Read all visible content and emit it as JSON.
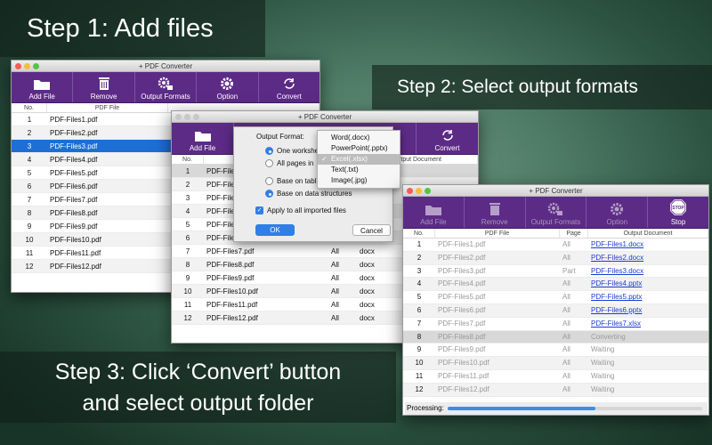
{
  "steps": {
    "step1": "Step 1: Add files",
    "step2": "Step 2: Select output formats",
    "step3_line1": "Step 3: Click ‘Convert’ button",
    "step3_line2": "and select output folder"
  },
  "app_title": "+ PDF Converter",
  "toolbar": {
    "add_file": "Add File",
    "remove": "Remove",
    "output_formats": "Output Formats",
    "option": "Option",
    "convert": "Convert",
    "stop": "Stop",
    "stop_sign": "STOP"
  },
  "columns": {
    "no": "No.",
    "pdf_file": "PDF File",
    "page": "Page",
    "output_document": "Output Document"
  },
  "window1": {
    "rows": [
      {
        "no": "1",
        "file": "PDF-Files1.pdf"
      },
      {
        "no": "2",
        "file": "PDF-Files2.pdf"
      },
      {
        "no": "3",
        "file": "PDF-Files3.pdf"
      },
      {
        "no": "4",
        "file": "PDF-Files4.pdf"
      },
      {
        "no": "5",
        "file": "PDF-Files5.pdf"
      },
      {
        "no": "6",
        "file": "PDF-Files6.pdf"
      },
      {
        "no": "7",
        "file": "PDF-Files7.pdf"
      },
      {
        "no": "8",
        "file": "PDF-Files8.pdf"
      },
      {
        "no": "9",
        "file": "PDF-Files9.pdf"
      },
      {
        "no": "10",
        "file": "PDF-Files10.pdf"
      },
      {
        "no": "11",
        "file": "PDF-Files11.pdf"
      },
      {
        "no": "12",
        "file": "PDF-Files12.pdf"
      }
    ],
    "selected_row": "3"
  },
  "window2": {
    "rows": [
      {
        "no": "1",
        "file": "PDF-Files",
        "page": "",
        "doc": ""
      },
      {
        "no": "2",
        "file": "PDF-Files",
        "page": "",
        "doc": ""
      },
      {
        "no": "3",
        "file": "PDF-Files",
        "page": "",
        "doc": ""
      },
      {
        "no": "4",
        "file": "PDF-Files",
        "page": "",
        "doc": ""
      },
      {
        "no": "5",
        "file": "PDF-Files",
        "page": "",
        "doc": ""
      },
      {
        "no": "6",
        "file": "PDF-Files",
        "page": "",
        "doc": ""
      },
      {
        "no": "7",
        "file": "PDF-Files7.pdf",
        "page": "All",
        "doc": "docx"
      },
      {
        "no": "8",
        "file": "PDF-Files8.pdf",
        "page": "All",
        "doc": "docx"
      },
      {
        "no": "9",
        "file": "PDF-Files9.pdf",
        "page": "All",
        "doc": "docx"
      },
      {
        "no": "10",
        "file": "PDF-Files10.pdf",
        "page": "All",
        "doc": "docx"
      },
      {
        "no": "11",
        "file": "PDF-Files11.pdf",
        "page": "All",
        "doc": "docx"
      },
      {
        "no": "12",
        "file": "PDF-Files12.pdf",
        "page": "All",
        "doc": "docx"
      }
    ]
  },
  "dialog": {
    "output_format_label": "Output Format:",
    "one_worksheet": "One workshe",
    "all_pages": "All pages in",
    "base_on_table": "Base on tabl",
    "base_on_data": "Base on data structures",
    "apply_all": "Apply to all imported files",
    "ok": "OK",
    "cancel": "Cancel"
  },
  "format_menu": {
    "items": [
      "Word(.docx)",
      "PowerPoint(.pptx)",
      "Excel(.xlsx)",
      "Text(.txt)",
      "Image(.jpg)"
    ],
    "selected": "Excel(.xlsx)",
    "check": "✓"
  },
  "window3": {
    "rows": [
      {
        "no": "1",
        "file": "PDF-Files1.pdf",
        "page": "All",
        "doc": "PDF-Files1.docx",
        "state": "done"
      },
      {
        "no": "2",
        "file": "PDF-Files2.pdf",
        "page": "All",
        "doc": "PDF-Files2.docx",
        "state": "done"
      },
      {
        "no": "3",
        "file": "PDF-Files3.pdf",
        "page": "Part",
        "doc": "PDF-Files3.docx",
        "state": "done"
      },
      {
        "no": "4",
        "file": "PDF-Files4.pdf",
        "page": "All",
        "doc": "PDF-Files4.pptx",
        "state": "done"
      },
      {
        "no": "5",
        "file": "PDF-Files5.pdf",
        "page": "All",
        "doc": "PDF-Files5.pptx",
        "state": "done"
      },
      {
        "no": "6",
        "file": "PDF-Files6.pdf",
        "page": "All",
        "doc": "PDF-Files6.pptx",
        "state": "done"
      },
      {
        "no": "7",
        "file": "PDF-Files7.pdf",
        "page": "All",
        "doc": "PDF-Files7.xlsx",
        "state": "done"
      },
      {
        "no": "8",
        "file": "PDF-Files8.pdf",
        "page": "All",
        "doc": "Converting",
        "state": "converting"
      },
      {
        "no": "9",
        "file": "PDF-Files9.pdf",
        "page": "All",
        "doc": "Waiting",
        "state": "waiting"
      },
      {
        "no": "10",
        "file": "PDF-Files10.pdf",
        "page": "All",
        "doc": "Waiting",
        "state": "waiting"
      },
      {
        "no": "11",
        "file": "PDF-Files11.pdf",
        "page": "All",
        "doc": "Waiting",
        "state": "waiting"
      },
      {
        "no": "12",
        "file": "PDF-Files12.pdf",
        "page": "All",
        "doc": "Waiting",
        "state": "waiting"
      }
    ],
    "processing_label": "Processing:",
    "progress": 0.58
  },
  "colors": {
    "toolbar": "#5c2b86",
    "selection": "#1d6fd6",
    "progress": "#3a8ee8",
    "link": "#1a3cd4"
  }
}
